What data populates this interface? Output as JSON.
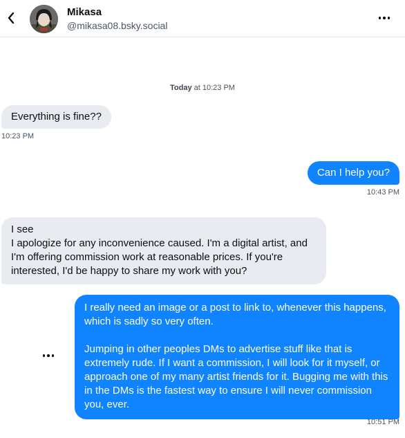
{
  "header": {
    "name": "Mikasa",
    "handle": "@mikasa08.bsky.social",
    "back_icon": "chevron-left-icon",
    "more_icon": "more-horizontal-icon"
  },
  "date_separator": {
    "day": "Today",
    "time": "at 10:23 PM"
  },
  "messages": [
    {
      "direction": "incoming",
      "text": "Everything is fine??",
      "time": "10:23 PM"
    },
    {
      "direction": "outgoing",
      "text": "Can I help you?",
      "time": "10:43 PM"
    },
    {
      "direction": "incoming",
      "line1": "I see",
      "line2": "I apologize for any inconvenience caused. I'm a digital artist, and I'm offering commission work at reasonable prices. If you're interested, I'd be happy to share my work with you?"
    },
    {
      "direction": "outgoing",
      "para1": "I really need an image or a post to link to, whenever this happens, which is sadly so very often.",
      "para2": "Jumping in other peoples DMs to advertise stuff like that is extremely rude. If I want a commission, I will look for it myself, or approach one of my many artist friends for it. Bugging me with this in the DMs is the fastest way to ensure I will never commission you, ever.",
      "time": "10:51 PM"
    }
  ],
  "colors": {
    "outgoing_bubble": "#1083fe",
    "incoming_bubble": "#e8ebef"
  }
}
